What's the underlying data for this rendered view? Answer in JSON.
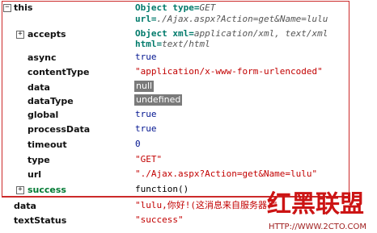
{
  "this_row": {
    "name": "this",
    "summary_line1_prefix": "Object type=",
    "summary_line1_italic": "GET",
    "summary_line2_prefix": "url=",
    "summary_line2_italic": "./Ajax.aspx?Action=get&Name=lulu"
  },
  "props": [
    {
      "key": "accepts",
      "line1_prefix": "Object xml=",
      "line1_italic": "application/xml, text/xml",
      "line2_prefix": "html=",
      "line2_italic": "text/html"
    },
    {
      "key": "async",
      "value": "true"
    },
    {
      "key": "contentType",
      "value": "\"application/x-www-form-urlencoded\""
    },
    {
      "key": "data",
      "value": "null"
    },
    {
      "key": "dataType",
      "value": "undefined"
    },
    {
      "key": "global",
      "value": "true"
    },
    {
      "key": "processData",
      "value": "true"
    },
    {
      "key": "timeout",
      "value": "0"
    },
    {
      "key": "type",
      "value": "\"GET\""
    },
    {
      "key": "url",
      "value": "\"./Ajax.aspx?Action=get&Name=lulu\""
    },
    {
      "key": "success",
      "value": "function()"
    }
  ],
  "outer": [
    {
      "key": "data",
      "value": "\"lulu,你好!(这消息来自服务器)\""
    },
    {
      "key": "textStatus",
      "value": "\"success\""
    }
  ],
  "watermark": {
    "text": "红黑联盟",
    "url": "HTTP://WWW.2CTO.COM"
  },
  "colors": {
    "border": "#cc2a2a",
    "string": "#c20000",
    "number": "#00138f",
    "object": "#007a6b",
    "badge": "#7a7a7a"
  }
}
